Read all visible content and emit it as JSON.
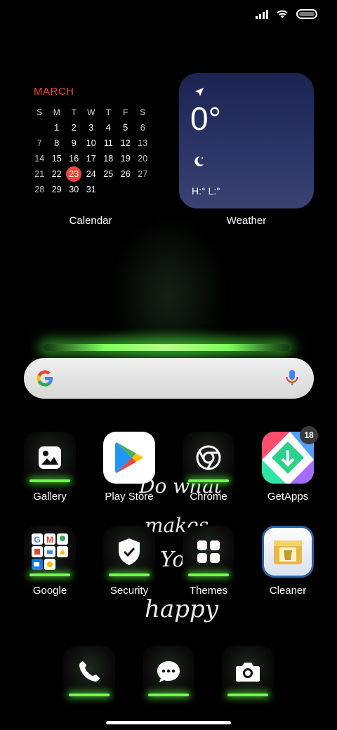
{
  "status_bar": {
    "icons": [
      "signal-icon",
      "wifi-icon",
      "battery-icon"
    ]
  },
  "calendar": {
    "month": "MARCH",
    "weekdays": [
      "S",
      "M",
      "T",
      "W",
      "T",
      "F",
      "S"
    ],
    "weeks": [
      [
        "",
        "1",
        "2",
        "3",
        "4",
        "5",
        "6"
      ],
      [
        "7",
        "8",
        "9",
        "10",
        "11",
        "12",
        "13"
      ],
      [
        "14",
        "15",
        "16",
        "17",
        "18",
        "19",
        "20"
      ],
      [
        "21",
        "22",
        "23",
        "24",
        "25",
        "26",
        "27"
      ],
      [
        "28",
        "29",
        "30",
        "31",
        "",
        "",
        ""
      ]
    ],
    "today": "23",
    "label": "Calendar"
  },
  "weather": {
    "temp": "0°",
    "hl": "H:° L:°",
    "label": "Weather"
  },
  "search": {
    "icons": [
      "google-logo",
      "microphone-icon"
    ]
  },
  "apps": [
    {
      "label": "Gallery",
      "icon": "gallery-icon"
    },
    {
      "label": "Play Store",
      "icon": "play-store-icon"
    },
    {
      "label": "Chrome",
      "icon": "chrome-icon"
    },
    {
      "label": "GetApps",
      "icon": "getapps-icon",
      "badge": "18"
    },
    {
      "label": "Google",
      "icon": "google-folder-icon"
    },
    {
      "label": "Security",
      "icon": "security-icon"
    },
    {
      "label": "Themes",
      "icon": "themes-icon"
    },
    {
      "label": "Cleaner",
      "icon": "cleaner-icon"
    }
  ],
  "dock": [
    "phone-icon",
    "messages-icon",
    "camera-icon"
  ],
  "wallpaper_text": [
    "Do what",
    "makes",
    "You",
    "happy"
  ],
  "colors": {
    "accent_red": "#f0443a",
    "glow_green": "#6dff4a",
    "weather_bg": "#1b2450"
  }
}
